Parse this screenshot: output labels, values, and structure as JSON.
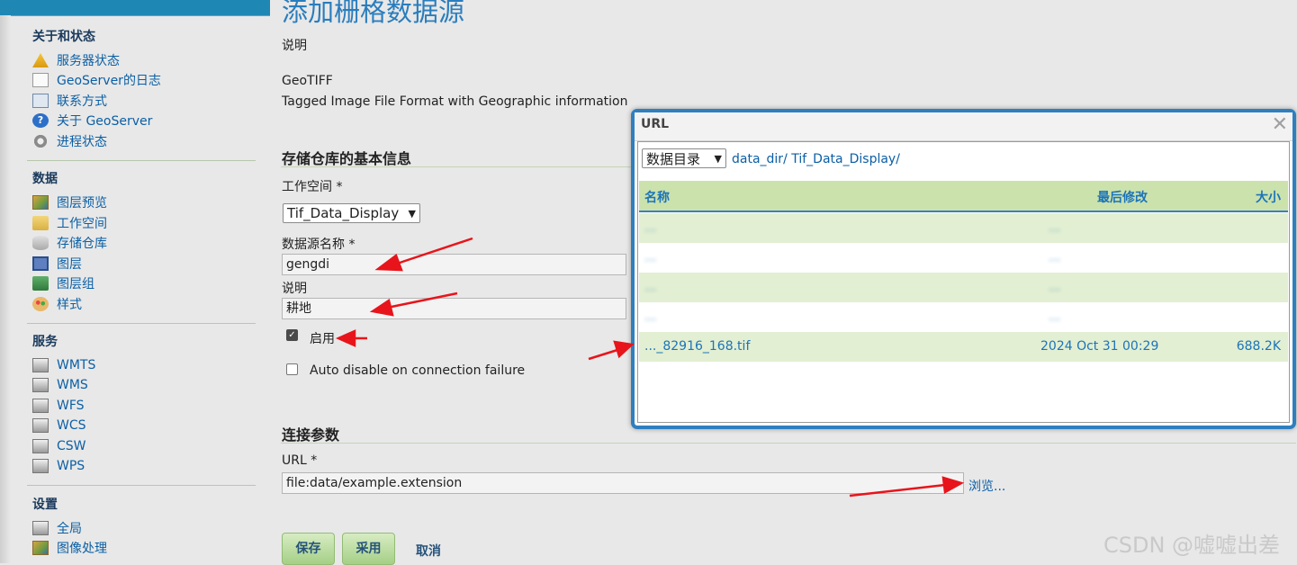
{
  "sidebar": {
    "sections": [
      {
        "title": "关于和状态",
        "items": [
          {
            "label": "服务器状态",
            "icon": "warning-icon"
          },
          {
            "label": "GeoServer的日志",
            "icon": "document-icon"
          },
          {
            "label": "联系方式",
            "icon": "contact-card-icon"
          },
          {
            "label": "关于 GeoServer",
            "icon": "help-icon"
          },
          {
            "label": "进程状态",
            "icon": "gear-icon"
          }
        ]
      },
      {
        "title": "数据",
        "items": [
          {
            "label": "图层预览",
            "icon": "map-preview-icon"
          },
          {
            "label": "工作空间",
            "icon": "folder-icon"
          },
          {
            "label": "存储仓库",
            "icon": "database-icon"
          },
          {
            "label": "图层",
            "icon": "layer-icon"
          },
          {
            "label": "图层组",
            "icon": "layer-group-icon"
          },
          {
            "label": "样式",
            "icon": "palette-icon"
          }
        ]
      },
      {
        "title": "服务",
        "items": [
          {
            "label": "WMTS",
            "icon": "server-icon"
          },
          {
            "label": "WMS",
            "icon": "server-icon"
          },
          {
            "label": "WFS",
            "icon": "server-icon"
          },
          {
            "label": "WCS",
            "icon": "server-icon"
          },
          {
            "label": "CSW",
            "icon": "server-icon"
          },
          {
            "label": "WPS",
            "icon": "server-icon"
          }
        ]
      },
      {
        "title": "设置",
        "items": [
          {
            "label": "全局",
            "icon": "server-icon"
          },
          {
            "label": "图像处理",
            "icon": "image-processing-icon"
          }
        ]
      }
    ]
  },
  "main": {
    "title": "添加栅格数据源",
    "description_label": "说明",
    "format_name": "GeoTIFF",
    "format_desc": "Tagged Image File Format with Geographic information",
    "basic_section": "存储仓库的基本信息",
    "workspace_label": "工作空间 *",
    "workspace_value": "Tif_Data_Display",
    "datasource_label": "数据源名称 *",
    "datasource_value": "gengdi",
    "desc_label": "说明",
    "desc_value": "耕地",
    "enabled_label": "启用",
    "enabled": true,
    "auto_disable_label": "Auto disable on connection failure",
    "auto_disable": false,
    "conn_section": "连接参数",
    "url_label": "URL *",
    "url_value": "file:data/example.extension",
    "browse": "浏览...",
    "buttons": {
      "save": "保存",
      "apply": "采用",
      "cancel": "取消"
    }
  },
  "dialog": {
    "title": "URL",
    "root_select": "数据目录",
    "path": "data_dir/ Tif_Data_Display/",
    "columns": {
      "name": "名称",
      "modified": "最后修改",
      "size": "大小"
    },
    "rows": [
      {
        "name": "...",
        "modified": "...",
        "size": "",
        "blurred": true
      },
      {
        "name": "...",
        "modified": "...",
        "size": "",
        "blurred": true
      },
      {
        "name": "...",
        "modified": "...",
        "size": "",
        "blurred": true
      },
      {
        "name": "...",
        "modified": "...",
        "size": "",
        "blurred": true
      },
      {
        "name": "..._82916_168.tif",
        "modified": "2024 Oct 31 00:29",
        "size": "688.2K",
        "blurred": false
      }
    ]
  },
  "watermark": "CSDN @嘘嘘出差",
  "colors": {
    "accent": "#2f7fbf",
    "link": "#0b5fa5",
    "header_green": "#cbe2ad",
    "annotation": "#e8141b"
  }
}
